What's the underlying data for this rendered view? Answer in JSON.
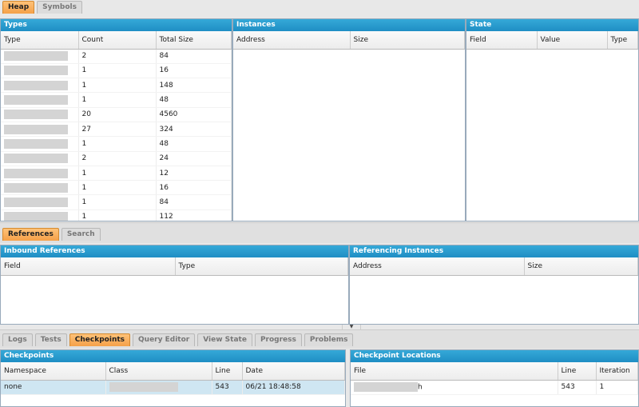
{
  "top_tabs": [
    "Heap",
    "Symbols"
  ],
  "types_panel": {
    "title": "Types",
    "columns": [
      "Type",
      "Count",
      "Total Size"
    ],
    "rows": [
      {
        "count": "2",
        "size": "84"
      },
      {
        "count": "1",
        "size": "16"
      },
      {
        "count": "1",
        "size": "148"
      },
      {
        "count": "1",
        "size": "48"
      },
      {
        "count": "20",
        "size": "4560"
      },
      {
        "count": "27",
        "size": "324"
      },
      {
        "count": "1",
        "size": "48"
      },
      {
        "count": "2",
        "size": "24"
      },
      {
        "count": "1",
        "size": "12"
      },
      {
        "count": "1",
        "size": "16"
      },
      {
        "count": "1",
        "size": "84"
      },
      {
        "count": "1",
        "size": "112"
      }
    ]
  },
  "instances_panel": {
    "title": "Instances",
    "columns": [
      "Address",
      "Size"
    ]
  },
  "state_panel": {
    "title": "State",
    "columns": [
      "Field",
      "Value",
      "Type"
    ]
  },
  "ref_tabs": [
    "References",
    "Search"
  ],
  "inbound_panel": {
    "title": "Inbound References",
    "columns": [
      "Field",
      "Type"
    ]
  },
  "referencing_panel": {
    "title": "Referencing Instances",
    "columns": [
      "Address",
      "Size"
    ]
  },
  "bottom_tabs": [
    "Logs",
    "Tests",
    "Checkpoints",
    "Query Editor",
    "View State",
    "Progress",
    "Problems"
  ],
  "checkpoints_panel": {
    "title": "Checkpoints",
    "columns": [
      "Namespace",
      "Class",
      "Line",
      "Date"
    ],
    "rows": [
      {
        "namespace": "none",
        "line": "543",
        "date": "06/21 18:48:58"
      }
    ]
  },
  "locations_panel": {
    "title": "Checkpoint Locations",
    "columns": [
      "File",
      "Line",
      "Iteration"
    ],
    "rows": [
      {
        "file_suffix": "h",
        "line": "543",
        "iteration": "1"
      }
    ]
  }
}
